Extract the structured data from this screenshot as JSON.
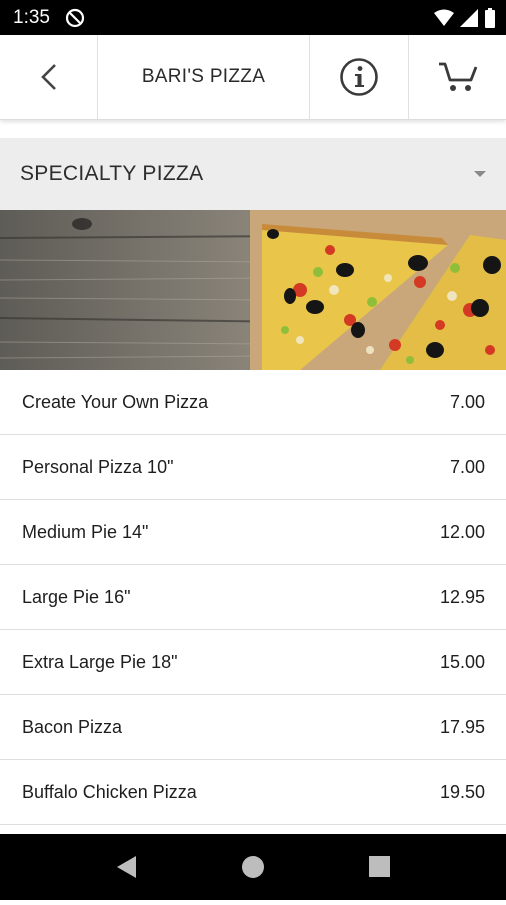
{
  "status_bar": {
    "time": "1:35"
  },
  "header": {
    "title": "BARI'S PIZZA"
  },
  "category": {
    "selected": "SPECIALTY PIZZA"
  },
  "menu_items": [
    {
      "name": "Create Your Own Pizza",
      "price": "7.00"
    },
    {
      "name": "Personal Pizza 10\"",
      "price": "7.00"
    },
    {
      "name": "Medium Pie 14\"",
      "price": "12.00"
    },
    {
      "name": "Large Pie 16\"",
      "price": "12.95"
    },
    {
      "name": "Extra Large Pie 18\"",
      "price": "15.00"
    },
    {
      "name": "Bacon Pizza",
      "price": "17.95"
    },
    {
      "name": "Buffalo Chicken Pizza",
      "price": "19.50"
    }
  ],
  "icons": {
    "status": [
      "at-sign-icon",
      "wifi-icon",
      "signal-icon",
      "battery-icon"
    ],
    "header": [
      "back-arrow-icon",
      "info-icon",
      "cart-icon"
    ],
    "nav": [
      "nav-back-icon",
      "nav-home-icon",
      "nav-recents-icon"
    ]
  },
  "colors": {
    "category_bg": "#ededed",
    "system_bars": "#000000"
  }
}
